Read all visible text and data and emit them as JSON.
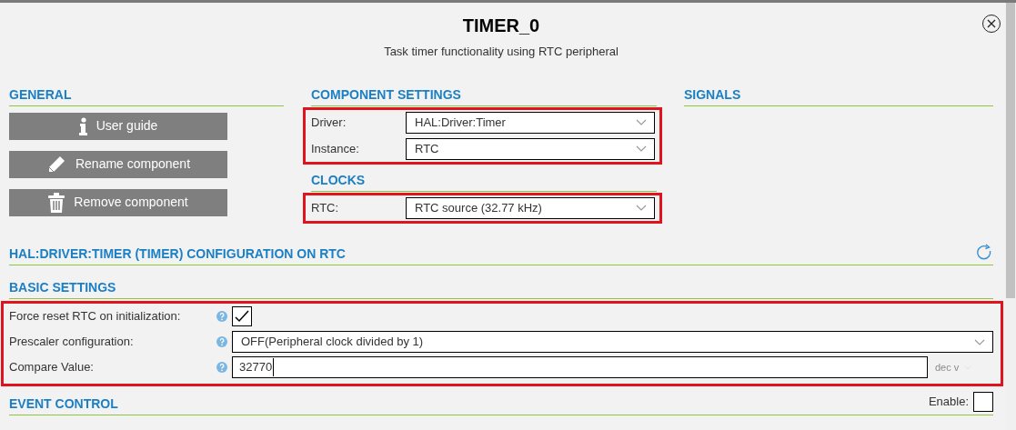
{
  "dialog": {
    "title": "TIMER_0",
    "subtitle": "Task timer functionality using RTC peripheral"
  },
  "general": {
    "heading": "GENERAL",
    "buttons": [
      {
        "kind": "info",
        "label": "User guide"
      },
      {
        "kind": "rename",
        "label": "Rename component"
      },
      {
        "kind": "remove",
        "label": "Remove component"
      }
    ]
  },
  "component_settings": {
    "heading": "COMPONENT SETTINGS",
    "highlighted": true,
    "fields": [
      {
        "label": "Driver:",
        "value": "HAL:Driver:Timer"
      },
      {
        "label": "Instance:",
        "value": "RTC"
      }
    ]
  },
  "clocks": {
    "heading": "CLOCKS",
    "highlighted": true,
    "fields": [
      {
        "label": "RTC:",
        "value": "RTC source (32.77 kHz)"
      }
    ]
  },
  "signals": {
    "heading": "SIGNALS"
  },
  "configuration": {
    "heading": "HAL:DRIVER:TIMER (TIMER) CONFIGURATION ON RTC",
    "basic_settings": {
      "heading": "BASIC SETTINGS",
      "highlighted": true,
      "rows": [
        {
          "kind": "checkbox",
          "label": "Force reset RTC on initialization:",
          "checked": true
        },
        {
          "kind": "select",
          "label": "Prescaler configuration:",
          "value": "OFF(Peripheral clock divided by 1)"
        },
        {
          "kind": "number",
          "label": "Compare Value:",
          "value": "32770",
          "unit": "dec v"
        }
      ]
    },
    "event_control": {
      "heading": "EVENT CONTROL",
      "enable_label": "Enable:",
      "enabled": false
    }
  }
}
